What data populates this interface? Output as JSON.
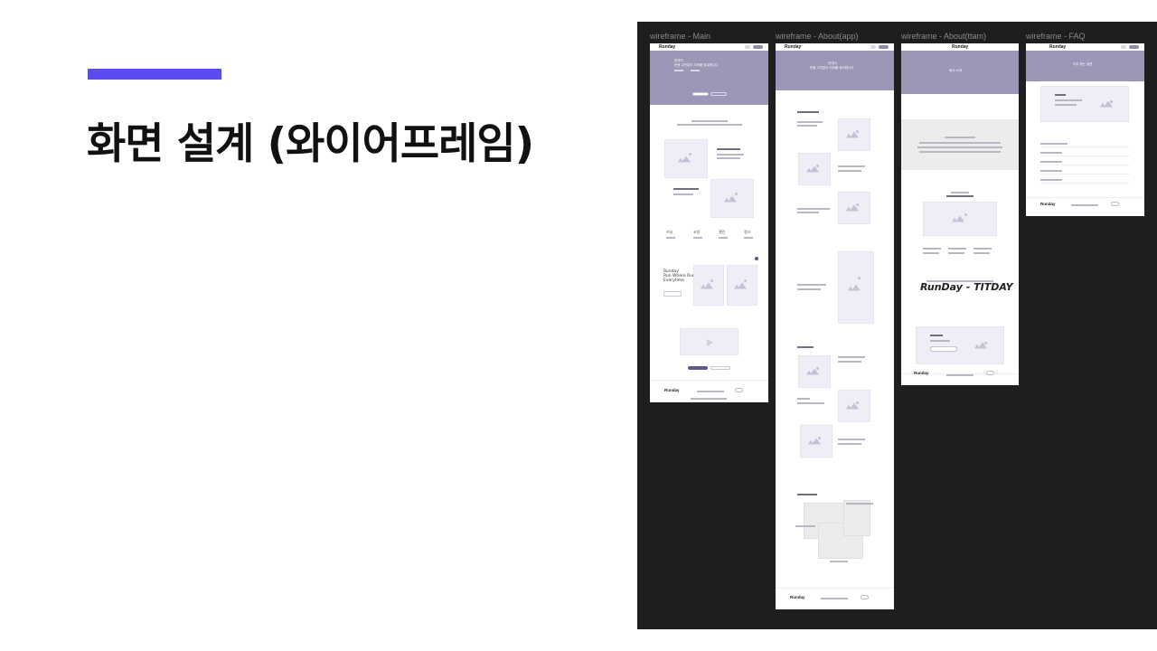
{
  "slide": {
    "title": "화면 설계 (와이어프레임)",
    "accent_color": "#5b4cf0"
  },
  "canvas": {
    "background": "#1e1e1e",
    "frames": [
      {
        "label": "wireframe - Main"
      },
      {
        "label": "wireframe - About(app)"
      },
      {
        "label": "wireframe - About(ttam)"
      },
      {
        "label": "wireframe - FAQ"
      }
    ]
  },
  "wireframe_text": {
    "logo": "Runday",
    "main_hero": [
      "런데이",
      "운동 고민없이 지켜볼 정교합니다"
    ],
    "main_features": [
      "러닝",
      "코칭",
      "챌린",
      "랭크"
    ],
    "main_promo": [
      "Runday",
      "Run Where Runs",
      "Everytime"
    ],
    "about_app_hero": [
      "런데이",
      "운동 고민없이 지켜볼 정교합니다"
    ],
    "about_ttam_hero": "회사 소개",
    "about_ttam_brand": "RunDay - TITDAY",
    "faq_hero": "자주 묻는 질문"
  }
}
